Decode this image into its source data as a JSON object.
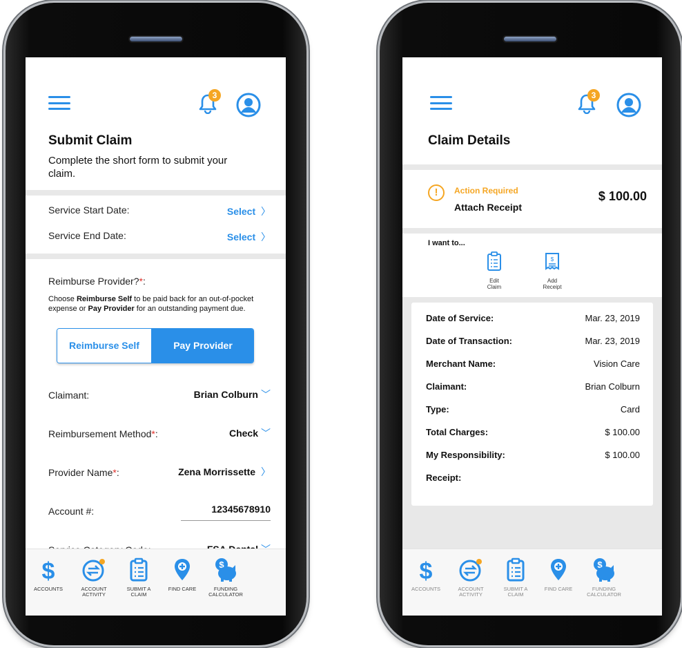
{
  "notifications": {
    "count": "3"
  },
  "submit": {
    "title": "Submit Claim",
    "subtitle": "Complete the short form to submit your claim.",
    "start_label": "Service Start Date:",
    "start_value": "Select",
    "end_label": "Service End Date:",
    "end_value": "Select",
    "reimburse_q": "Reimburse Provider?",
    "reimburse_help_1": "Choose ",
    "reimburse_help_self": "Reimburse Self",
    "reimburse_help_2": " to be paid back for an out-of-pocket expense or ",
    "reimburse_help_provider": "Pay Provider",
    "reimburse_help_3": " for an outstanding payment due.",
    "toggle_self": "Reimburse Self",
    "toggle_provider": "Pay Provider",
    "claimant_label": "Claimant:",
    "claimant_value": "Brian Colburn",
    "method_label": "Reimbursement Method",
    "method_value": "Check",
    "provider_label": "Provider Name",
    "provider_value": "Zena Morrissette",
    "account_label": "Account #:",
    "account_value": "12345678910",
    "category_label": "Service Category Code:",
    "category_value": "FSA Dental"
  },
  "details": {
    "title": "Claim Details",
    "action_required": "Action Required",
    "attach_receipt": "Attach Receipt",
    "amount": "$ 100.00",
    "i_want_to": "I want to...",
    "edit_1": "Edit",
    "edit_2": "Claim",
    "add_1": "Add",
    "add_2": "Receipt",
    "rows": [
      {
        "k": "Date of Service:",
        "v": "Mar. 23, 2019"
      },
      {
        "k": "Date of Transaction:",
        "v": "Mar. 23, 2019"
      },
      {
        "k": "Merchant Name:",
        "v": "Vision Care"
      },
      {
        "k": "Claimant:",
        "v": "Brian Colburn"
      },
      {
        "k": "Type:",
        "v": "Card"
      },
      {
        "k": "Total Charges:",
        "v": "$ 100.00"
      },
      {
        "k": "My Responsibility:",
        "v": "$ 100.00"
      },
      {
        "k": "Receipt:",
        "v": ""
      }
    ]
  },
  "nav": {
    "accounts": "ACCOUNTS",
    "activity_1": "ACCOUNT",
    "activity_2": "ACTIVITY",
    "submit_1": "SUBMIT A",
    "submit_2": "CLAIM",
    "find_care": "FIND CARE",
    "funding_1": "FUNDING",
    "funding_2": "CALCULATOR"
  },
  "colors": {
    "accent": "#2a8fe8",
    "warning": "#f5a623",
    "required": "#e0312b"
  }
}
